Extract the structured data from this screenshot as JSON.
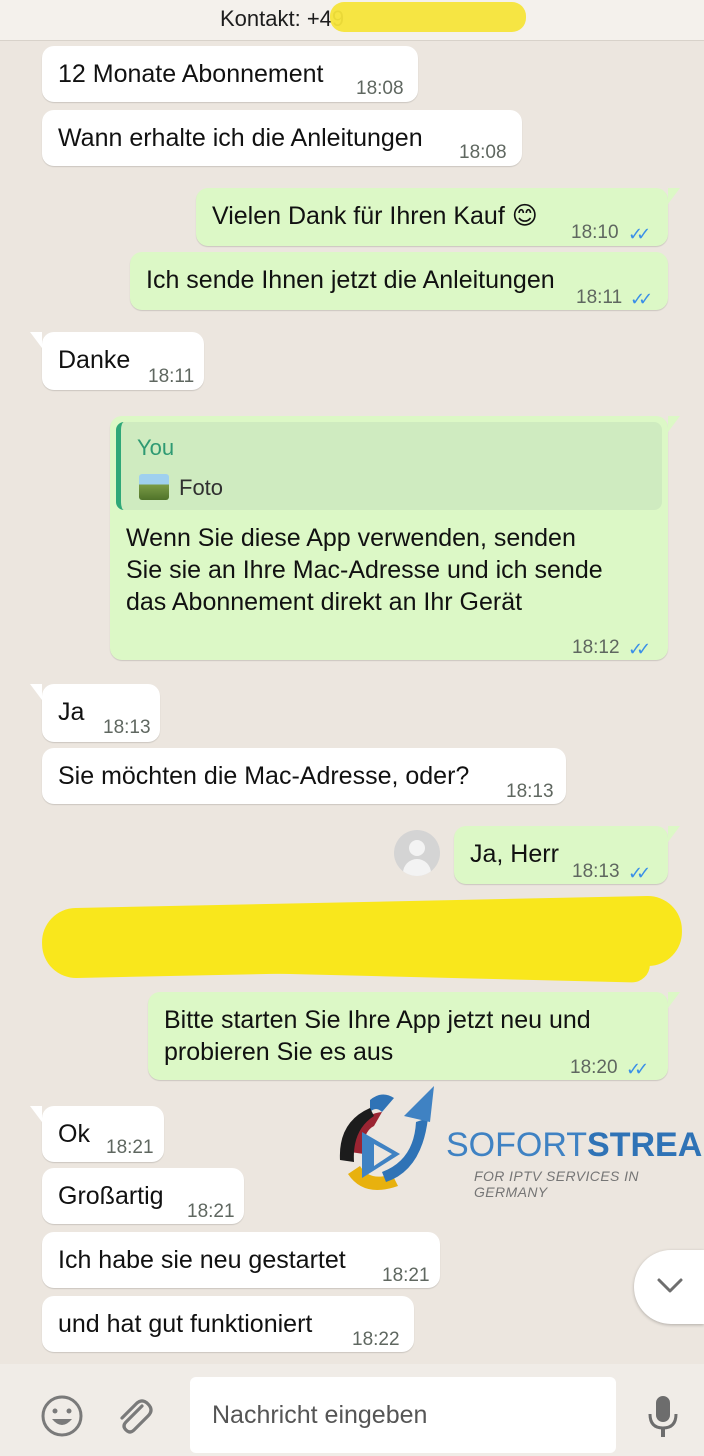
{
  "header": {
    "title": "Kontakt: +49"
  },
  "messages": [
    {
      "text": "12 Monate Abonnement",
      "time": "18:08",
      "direction": "in"
    },
    {
      "text": "Wann erhalte ich die Anleitungen",
      "time": "18:08",
      "direction": "in"
    },
    {
      "text": "Vielen Dank für Ihren Kauf 😊",
      "time": "18:10",
      "direction": "out"
    },
    {
      "text": "Ich sende Ihnen jetzt die Anleitungen",
      "time": "18:11",
      "direction": "out"
    },
    {
      "text": "Danke",
      "time": "18:11",
      "direction": "in"
    },
    {
      "text": "Wenn Sie diese App verwenden, senden\nSie sie an Ihre Mac-Adresse und ich sende\ndas Abonnement direkt an Ihr Gerät",
      "time": "18:12",
      "direction": "out",
      "reply": {
        "author": "You",
        "label": "Foto"
      }
    },
    {
      "text": "Ja",
      "time": "18:13",
      "direction": "in"
    },
    {
      "text": "Sie möchten die Mac-Adresse, oder?",
      "time": "18:13",
      "direction": "in"
    },
    {
      "text": "Ja, Herr",
      "time": "18:13",
      "direction": "out"
    },
    {
      "text": "Bitte starten Sie Ihre App jetzt neu und\nprobieren Sie es aus",
      "time": "18:20",
      "direction": "out"
    },
    {
      "text": "Ok",
      "time": "18:21",
      "direction": "in"
    },
    {
      "text": "Großartig",
      "time": "18:21",
      "direction": "in"
    },
    {
      "text": "Ich habe sie neu gestartet",
      "time": "18:21",
      "direction": "in"
    },
    {
      "text": "und hat gut funktioniert",
      "time": "18:22",
      "direction": "in"
    }
  ],
  "read_ticks": "✓✓",
  "watermark": {
    "brand_light": "SOFORT",
    "brand_bold": "STREAM",
    "tagline": "FOR IPTV SERVICES IN GERMANY"
  },
  "composer": {
    "placeholder": "Nachricht eingeben"
  },
  "colors": {
    "incoming": "#ffffff",
    "outgoing": "#dcf8c6",
    "tick": "#3a8fe8",
    "background": "#ece6df",
    "redaction": "#f9e71c"
  },
  "icons": [
    "emoji-icon",
    "attach-icon",
    "mic-icon",
    "chevron-down-icon",
    "avatar-icon"
  ]
}
